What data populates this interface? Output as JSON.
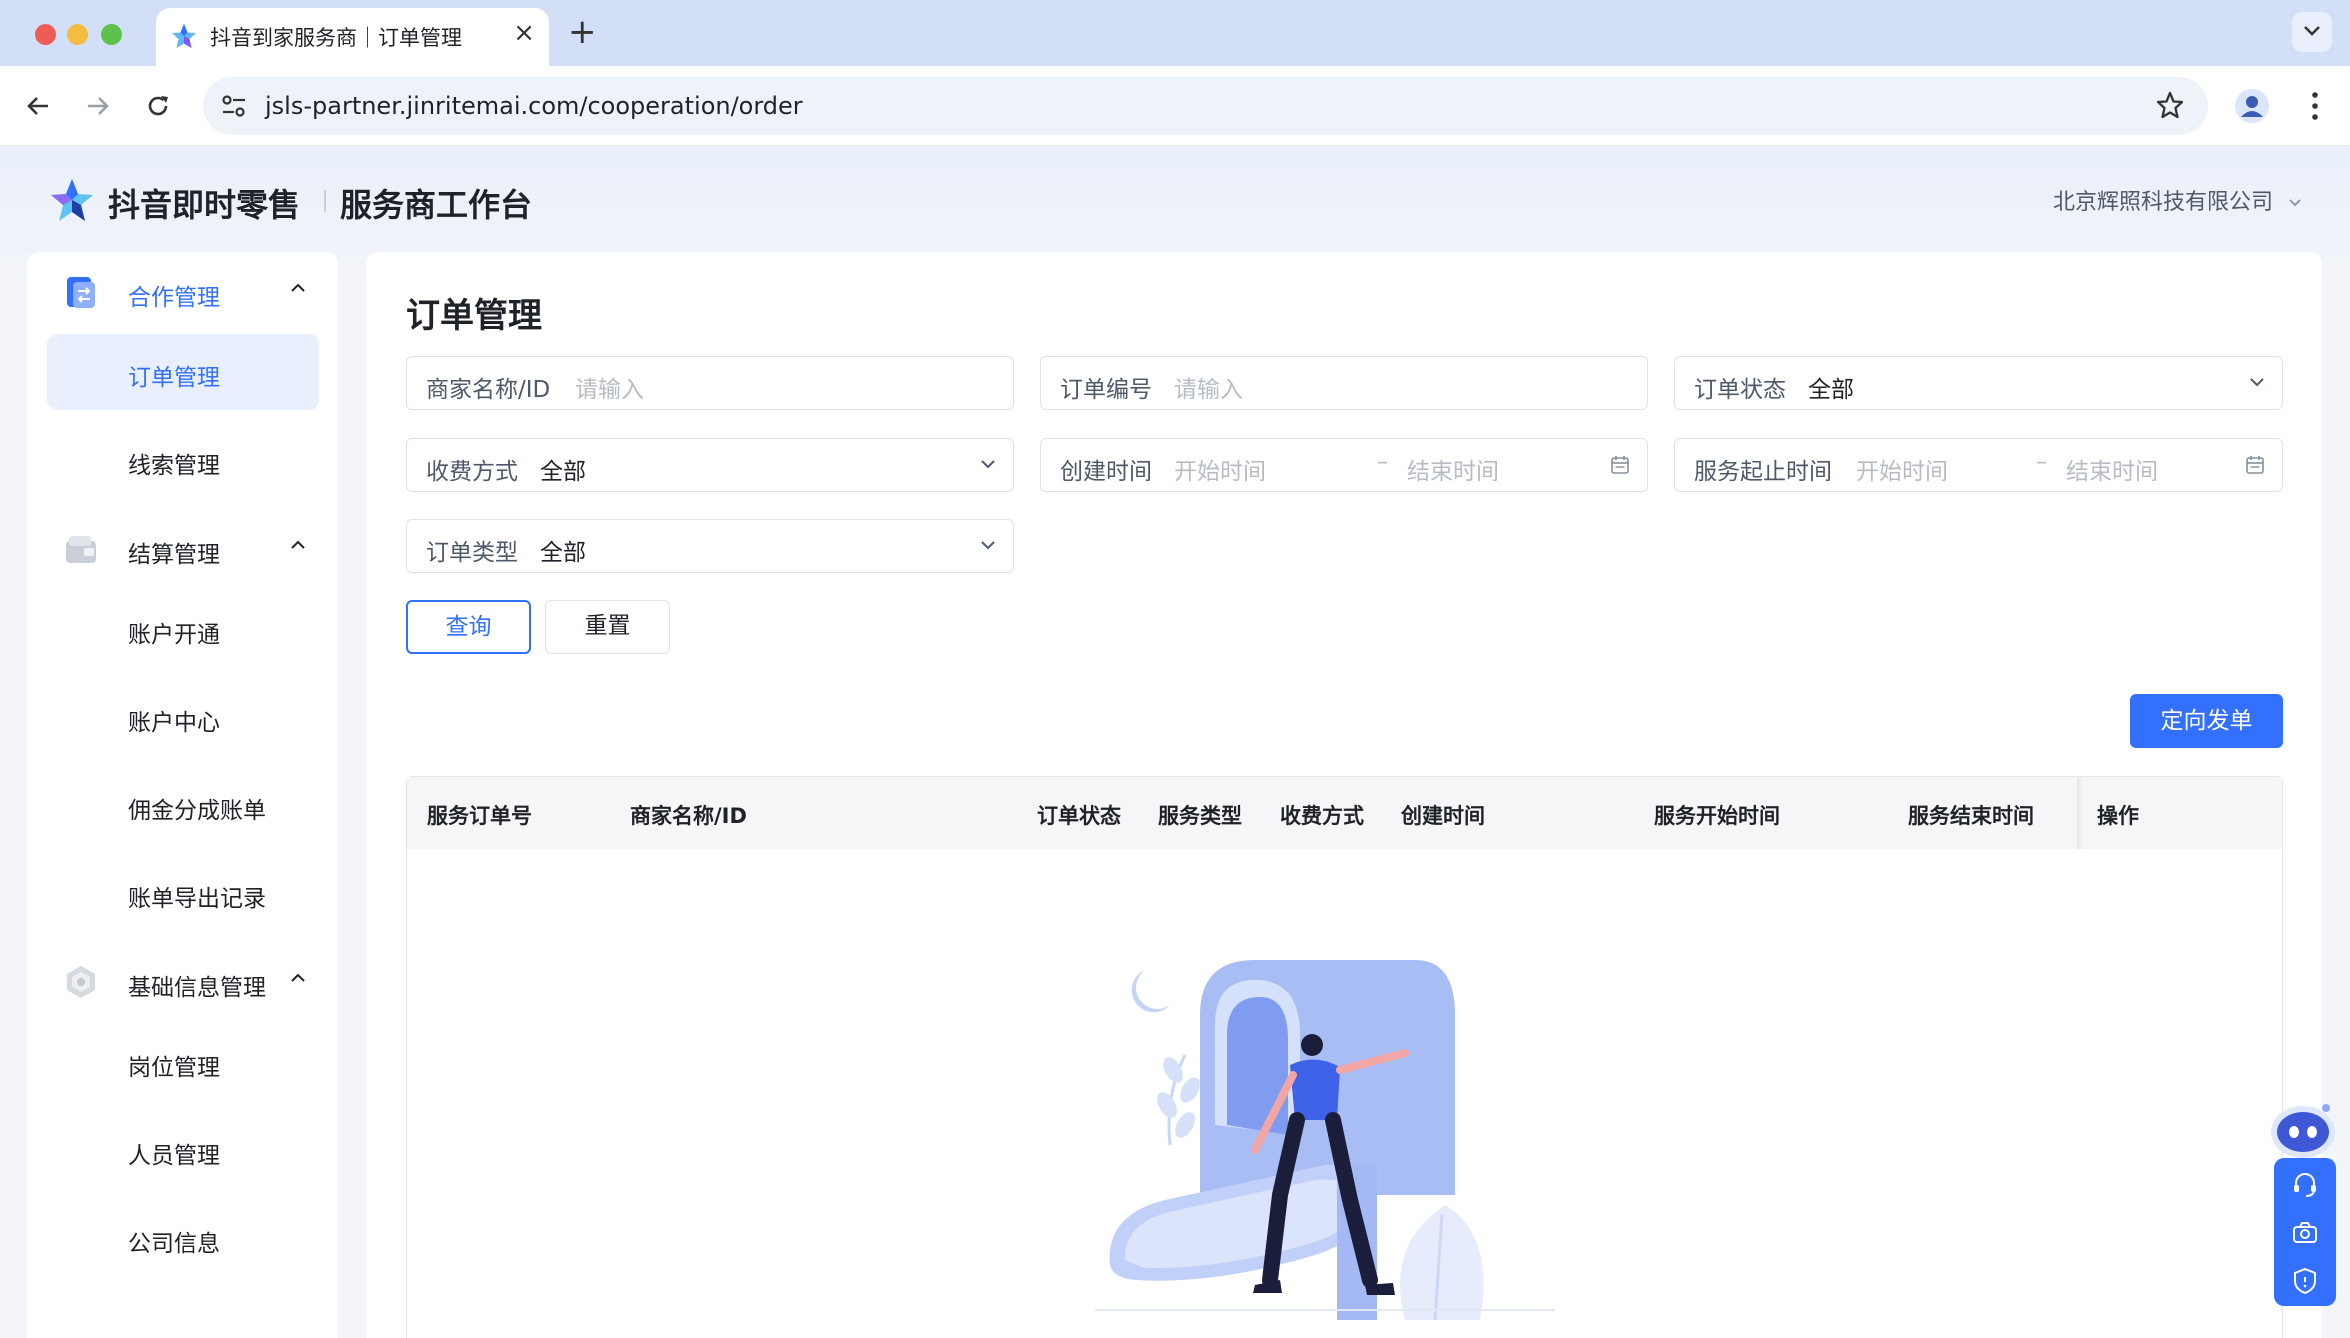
{
  "browser": {
    "tab_title": "抖音到家服务商｜订单管理",
    "url": "jsls-partner.jinritemai.com/cooperation/order"
  },
  "header": {
    "brand_name": "抖音即时零售",
    "brand_subtitle": "服务商工作台",
    "company": "北京辉照科技有限公司"
  },
  "sidebar": {
    "groups": [
      {
        "label": "合作管理",
        "icon": "cooperation-icon",
        "active": true
      },
      {
        "label": "结算管理",
        "icon": "wallet-icon"
      },
      {
        "label": "基础信息管理",
        "icon": "shield-icon"
      }
    ],
    "items": [
      {
        "label": "订单管理",
        "active": true
      },
      {
        "label": "线索管理"
      },
      {
        "label": "账户开通"
      },
      {
        "label": "账户中心"
      },
      {
        "label": "佣金分成账单"
      },
      {
        "label": "账单导出记录"
      },
      {
        "label": "岗位管理"
      },
      {
        "label": "人员管理"
      },
      {
        "label": "公司信息"
      }
    ]
  },
  "main": {
    "title": "订单管理",
    "filters": {
      "merchant": {
        "label": "商家名称/ID",
        "placeholder": "请输入"
      },
      "order_no": {
        "label": "订单编号",
        "placeholder": "请输入"
      },
      "order_status": {
        "label": "订单状态",
        "value": "全部"
      },
      "fee_method": {
        "label": "收费方式",
        "value": "全部"
      },
      "created_time": {
        "label": "创建时间",
        "start_placeholder": "开始时间",
        "end_placeholder": "结束时间",
        "separator": "–"
      },
      "service_time": {
        "label": "服务起止时间",
        "start_placeholder": "开始时间",
        "end_placeholder": "结束时间",
        "separator": "–"
      },
      "order_type": {
        "label": "订单类型",
        "value": "全部"
      }
    },
    "buttons": {
      "query": "查询",
      "reset": "重置",
      "dispatch": "定向发单"
    },
    "table": {
      "columns": [
        "服务订单号",
        "商家名称/ID",
        "订单状态",
        "服务类型",
        "收费方式",
        "创建时间",
        "服务开始时间",
        "服务结束时间",
        "操作"
      ],
      "rows": []
    }
  },
  "colors": {
    "accent": "#3370ff",
    "tabbar": "#d3dff6",
    "active_bg": "#e9effd"
  }
}
